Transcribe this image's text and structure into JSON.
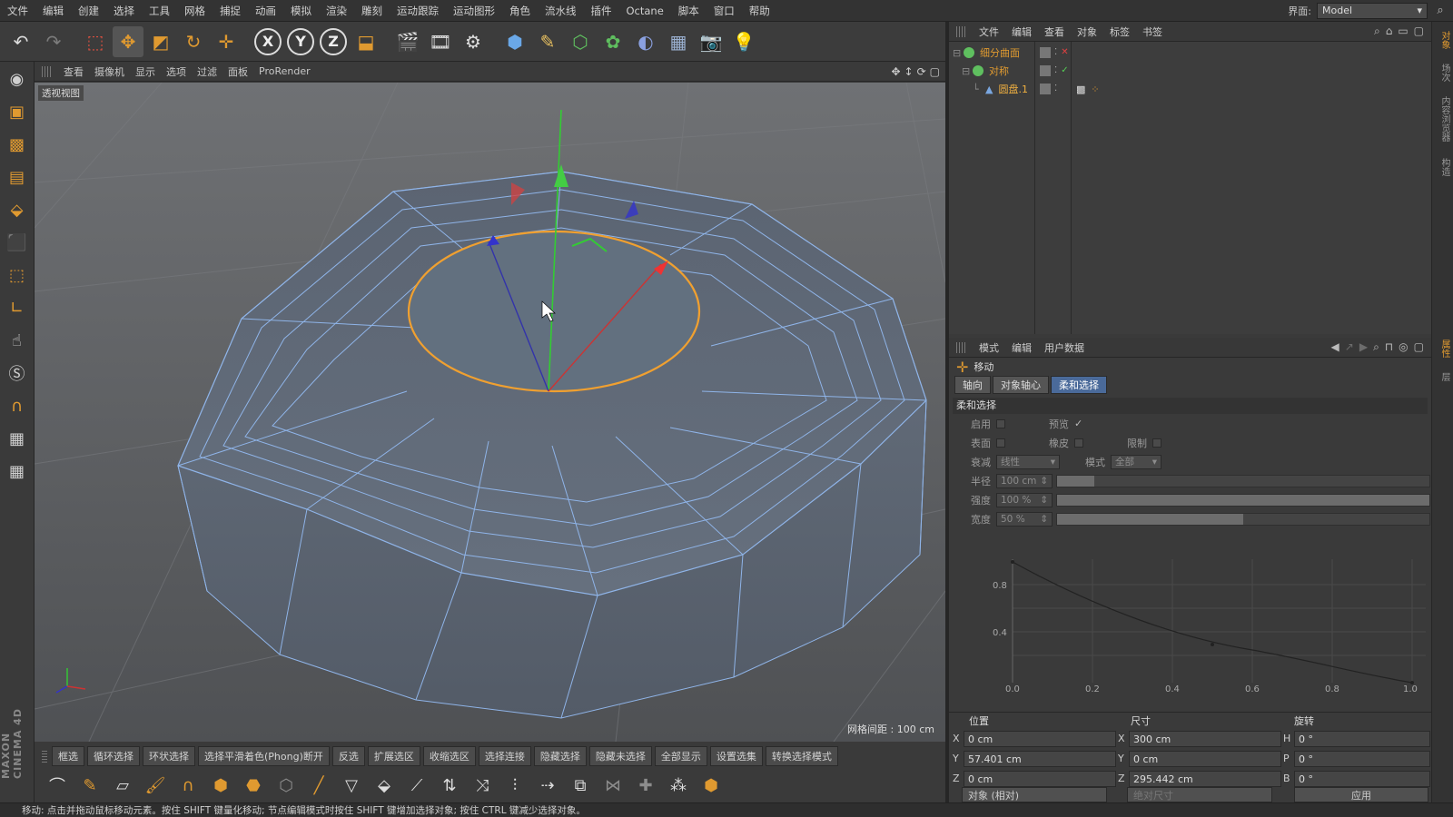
{
  "menu": [
    "文件",
    "编辑",
    "创建",
    "选择",
    "工具",
    "网格",
    "捕捉",
    "动画",
    "模拟",
    "渲染",
    "雕刻",
    "运动跟踪",
    "运动图形",
    "角色",
    "流水线",
    "插件",
    "Octane",
    "脚本",
    "窗口",
    "帮助"
  ],
  "layout": {
    "label": "界面:",
    "value": "Model"
  },
  "viewport": {
    "menu": [
      "查看",
      "摄像机",
      "显示",
      "选项",
      "过滤",
      "面板",
      "ProRender"
    ],
    "view_name": "透视视图",
    "grid_distance": "网格间距 : 100 cm"
  },
  "selection_bar": [
    "框选",
    "循环选择",
    "环状选择",
    "选择平滑着色(Phong)断开",
    "反选",
    "扩展选区",
    "收缩选区",
    "选择连接",
    "隐藏选择",
    "隐藏未选择",
    "全部显示",
    "设置选集",
    "转换选择模式"
  ],
  "status": "移动: 点击并拖动鼠标移动元素。按住 SHIFT 键量化移动; 节点编辑模式时按住 SHIFT 键增加选择对象; 按住 CTRL 键减少选择对象。",
  "brand": "MAXON CINEMA 4D",
  "objects": {
    "menu": [
      "文件",
      "编辑",
      "查看",
      "对象",
      "标签",
      "书签"
    ],
    "items": [
      {
        "name": "细分曲面",
        "color": "#5fbf5f"
      },
      {
        "name": "对称",
        "color": "#5fbf5f"
      },
      {
        "name": "圆盘.1",
        "color": "#7aa7e0"
      }
    ]
  },
  "attributes": {
    "menu": [
      "模式",
      "编辑",
      "用户数据"
    ],
    "tool": "移动",
    "tabs": [
      "轴向",
      "对象轴心",
      "柔和选择"
    ],
    "active_tab": "柔和选择",
    "group": "柔和选择",
    "enable": "启用",
    "preview": "预览",
    "surface": "表面",
    "rubber": "橡皮",
    "limit": "限制",
    "falloff_label": "衰减",
    "falloff_value": "线性",
    "mode_label": "模式",
    "mode_value": "全部",
    "radius_label": "半径",
    "radius_value": "100 cm",
    "radius_fill": 0.1,
    "strength_label": "强度",
    "strength_value": "100 %",
    "strength_fill": 1.0,
    "width_label": "宽度",
    "width_value": "50 %",
    "width_fill": 0.5
  },
  "curve": {
    "y_ticks": [
      "0.8",
      "0.4"
    ],
    "x_ticks": [
      "0.0",
      "0.2",
      "0.4",
      "0.6",
      "0.8",
      "1.0"
    ]
  },
  "coords": {
    "heads": [
      "位置",
      "尺寸",
      "旋转"
    ],
    "rows": [
      {
        "axis": "X",
        "pos": "0 cm",
        "size_axis": "X",
        "size": "300 cm",
        "rot_axis": "H",
        "rot": "0 °"
      },
      {
        "axis": "Y",
        "pos": "57.401 cm",
        "size_axis": "Y",
        "size": "0 cm",
        "rot_axis": "P",
        "rot": "0 °"
      },
      {
        "axis": "Z",
        "pos": "0 cm",
        "size_axis": "Z",
        "size": "295.442 cm",
        "rot_axis": "B",
        "rot": "0 °"
      }
    ],
    "mode": "对象 (相对)",
    "size_mode": "绝对尺寸",
    "apply": "应用"
  },
  "side_tabs": [
    "对象",
    "场次",
    "内容浏览器",
    "构造",
    "属性",
    "层"
  ]
}
